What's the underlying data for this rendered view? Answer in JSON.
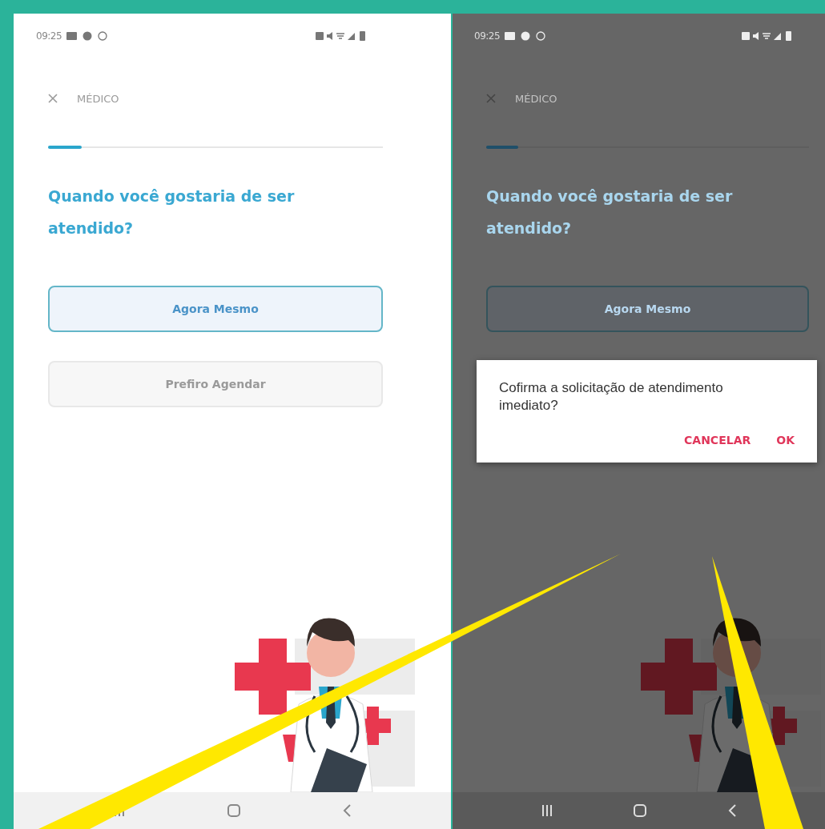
{
  "screens": [
    {
      "dimmed": false,
      "status_time": "09:25",
      "title": "MÉDICO",
      "progress": {
        "level": 0.1
      },
      "question": "Quando você gostaria de ser atendido?",
      "options": [
        {
          "label": "Agora Mesmo",
          "selected": true,
          "disabled": false
        },
        {
          "label": "Prefiro Agendar",
          "selected": false,
          "disabled": true
        }
      ]
    },
    {
      "dimmed": true,
      "status_time": "09:25",
      "title": "MÉDICO",
      "progress": {
        "level": 0.1
      },
      "question": "Quando você gostaria de ser atendido?",
      "options": [
        {
          "label": "Agora Mesmo",
          "selected": true,
          "disabled": false
        }
      ],
      "dialog": {
        "message": "Cofirma a solicitação de atendimento imediato?",
        "buttons": [
          "CANCELAR",
          "OK"
        ]
      }
    }
  ]
}
